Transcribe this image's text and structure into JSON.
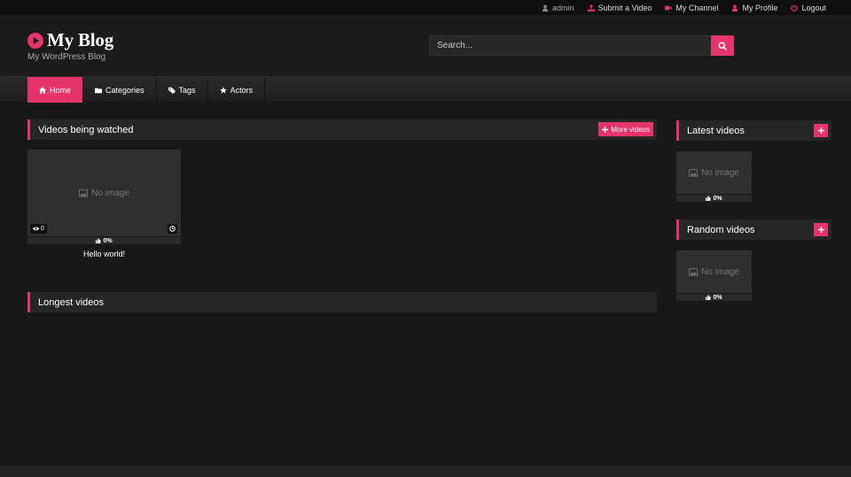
{
  "colors": {
    "accent": "#e5336b",
    "background": "#181818",
    "header": "#1b1b1b"
  },
  "topbar": {
    "links": [
      {
        "label": "admin",
        "icon": "user-icon"
      },
      {
        "label": "Submit a Video",
        "icon": "upload-icon"
      },
      {
        "label": "My Channel",
        "icon": "video-camera-icon"
      },
      {
        "label": "My Profile",
        "icon": "user-icon"
      },
      {
        "label": "Logout",
        "icon": "power-icon"
      }
    ]
  },
  "header": {
    "site_title": "My Blog",
    "tagline": "My WordPress Blog",
    "logo_icon": "play-circle-icon"
  },
  "search": {
    "placeholder": "Search...",
    "icon": "search-icon"
  },
  "nav": {
    "items": [
      {
        "label": "Home",
        "icon": "home-icon",
        "active": true
      },
      {
        "label": "Categories",
        "icon": "folder-icon"
      },
      {
        "label": "Tags",
        "icon": "tags-icon"
      },
      {
        "label": "Actors",
        "icon": "star-icon"
      }
    ]
  },
  "main": {
    "watched": {
      "title": "Videos being watched",
      "more_label": "More videos",
      "videos": [
        {
          "title": "Hello world!",
          "thumb_text": "No image",
          "views": "0",
          "rating": "0%"
        }
      ]
    },
    "longest": {
      "title": "Longest videos"
    }
  },
  "sidebar": {
    "latest": {
      "title": "Latest videos",
      "thumb_text": "No image",
      "rating": "0%"
    },
    "random": {
      "title": "Random videos",
      "thumb_text": "No image",
      "rating": "0%"
    }
  }
}
